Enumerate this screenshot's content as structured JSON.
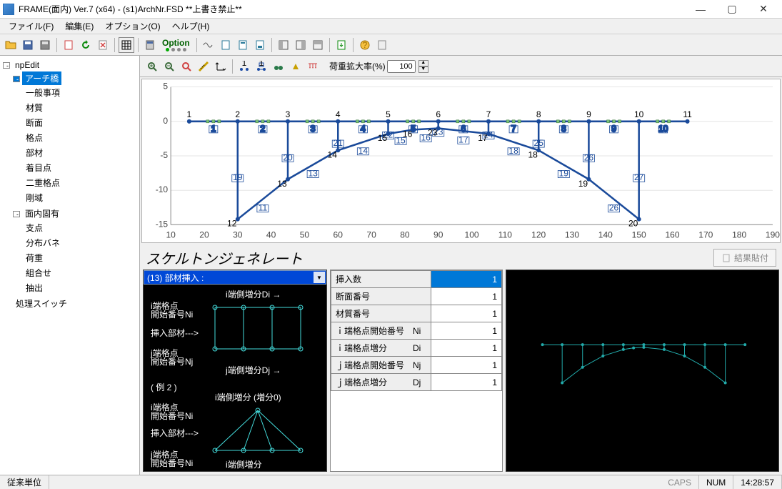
{
  "title": "FRAME(面内) Ver.7 (x64) - (s1)ArchNr.FSD **上書き禁止**",
  "menu": {
    "file": "ファイル(F)",
    "edit": "編集(E)",
    "option": "オプション(O)",
    "help": "ヘルプ(H)"
  },
  "toolbar": {
    "option_label": "Option"
  },
  "subtoolbar": {
    "load_scale_label": "荷重拡大率(%)",
    "load_scale_value": "100"
  },
  "tree": {
    "root": "npEdit",
    "arch": "アーチ橋",
    "items": [
      "一般事項",
      "材質",
      "断面",
      "格点",
      "部材",
      "着目点",
      "二重格点",
      "剛域"
    ],
    "inplane": "面内固有",
    "inplane_items": [
      "支点",
      "分布バネ",
      "荷重",
      "組合せ",
      "抽出"
    ],
    "proc": "処理スイッチ"
  },
  "chart_data": {
    "type": "line",
    "xlabel": "",
    "ylabel": "",
    "xlim": [
      10,
      190
    ],
    "ylim": [
      -15,
      5
    ],
    "xticks": [
      10,
      20,
      30,
      40,
      50,
      60,
      70,
      80,
      90,
      100,
      110,
      120,
      130,
      140,
      150,
      160,
      170,
      180,
      190
    ],
    "yticks": [
      5,
      0,
      -5,
      -10,
      -15
    ],
    "deck_nodes": [
      {
        "id": 1,
        "x": 15.5,
        "y": 0
      },
      {
        "id": 2,
        "x": 30.0,
        "y": 0
      },
      {
        "id": 3,
        "x": 45.0,
        "y": 0
      },
      {
        "id": 4,
        "x": 60.0,
        "y": 0
      },
      {
        "id": 5,
        "x": 75.0,
        "y": 0
      },
      {
        "id": 6,
        "x": 90.0,
        "y": 0
      },
      {
        "id": 7,
        "x": 105.0,
        "y": 0
      },
      {
        "id": 8,
        "x": 120.0,
        "y": 0
      },
      {
        "id": 9,
        "x": 135.0,
        "y": 0
      },
      {
        "id": 10,
        "x": 150.0,
        "y": 0
      },
      {
        "id": 11,
        "x": 164.5,
        "y": 0
      }
    ],
    "arch_nodes": [
      {
        "id": 12,
        "x": 30.0,
        "y": -14.2
      },
      {
        "id": 13,
        "x": 45.0,
        "y": -8.4
      },
      {
        "id": 14,
        "x": 60.0,
        "y": -4.2
      },
      {
        "id": 15,
        "x": 75.0,
        "y": -1.8
      },
      {
        "id": 16,
        "x": 82.5,
        "y": -1.2
      },
      {
        "id": 23,
        "x": 90.0,
        "y": -1.0
      },
      {
        "id": 17,
        "x": 105.0,
        "y": -1.8
      },
      {
        "id": 18,
        "x": 120.0,
        "y": -4.2
      },
      {
        "id": 19,
        "x": 135.0,
        "y": -8.4
      },
      {
        "id": 20,
        "x": 150.0,
        "y": -14.2
      }
    ],
    "deck_members": [
      1,
      2,
      3,
      4,
      5,
      6,
      7,
      8,
      9,
      10
    ],
    "arch_members": [
      11,
      13,
      14,
      15,
      16,
      17,
      18,
      19,
      26,
      27
    ],
    "column_members": [
      19,
      20,
      21,
      22,
      23,
      24,
      25,
      26,
      27
    ]
  },
  "skeleton_title": "スケルトンジェネレート",
  "combo_text": "(13) 部材挿入 :",
  "result_btn": "結果貼付",
  "diagram": {
    "i_delta": "i端側増分Di →",
    "i_node": "i端格点",
    "i_start": "開始番号Ni",
    "insert": "挿入部材--->",
    "j_node": "j端格点",
    "j_start": "開始番号Nj",
    "j_delta": "j端側増分Dj →",
    "ex2": "( 例 2 )",
    "i_delta2": "i端側増分 (増分0)",
    "i_node2": "i端格点",
    "i_start2": "開始番号Ni",
    "insert2": "挿入部材--->",
    "j_node2": "j端格点",
    "j_start2": "開始番号Ni",
    "j_delta2": "i端側増分"
  },
  "table": {
    "rows": [
      {
        "label": "挿入数",
        "value": "1",
        "hdr": true
      },
      {
        "label": "断面番号",
        "value": "1"
      },
      {
        "label": "材質番号",
        "value": "1"
      },
      {
        "label": "ｉ端格点開始番号　Ni",
        "value": "1"
      },
      {
        "label": "ｉ端格点増分　　　Di",
        "value": "1"
      },
      {
        "label": "ｊ端格点開始番号　Nj",
        "value": "1"
      },
      {
        "label": "ｊ端格点増分　　　Dj",
        "value": "1"
      }
    ]
  },
  "status": {
    "unit": "従来単位",
    "caps": "CAPS",
    "num": "NUM",
    "time": "14:28:57"
  }
}
